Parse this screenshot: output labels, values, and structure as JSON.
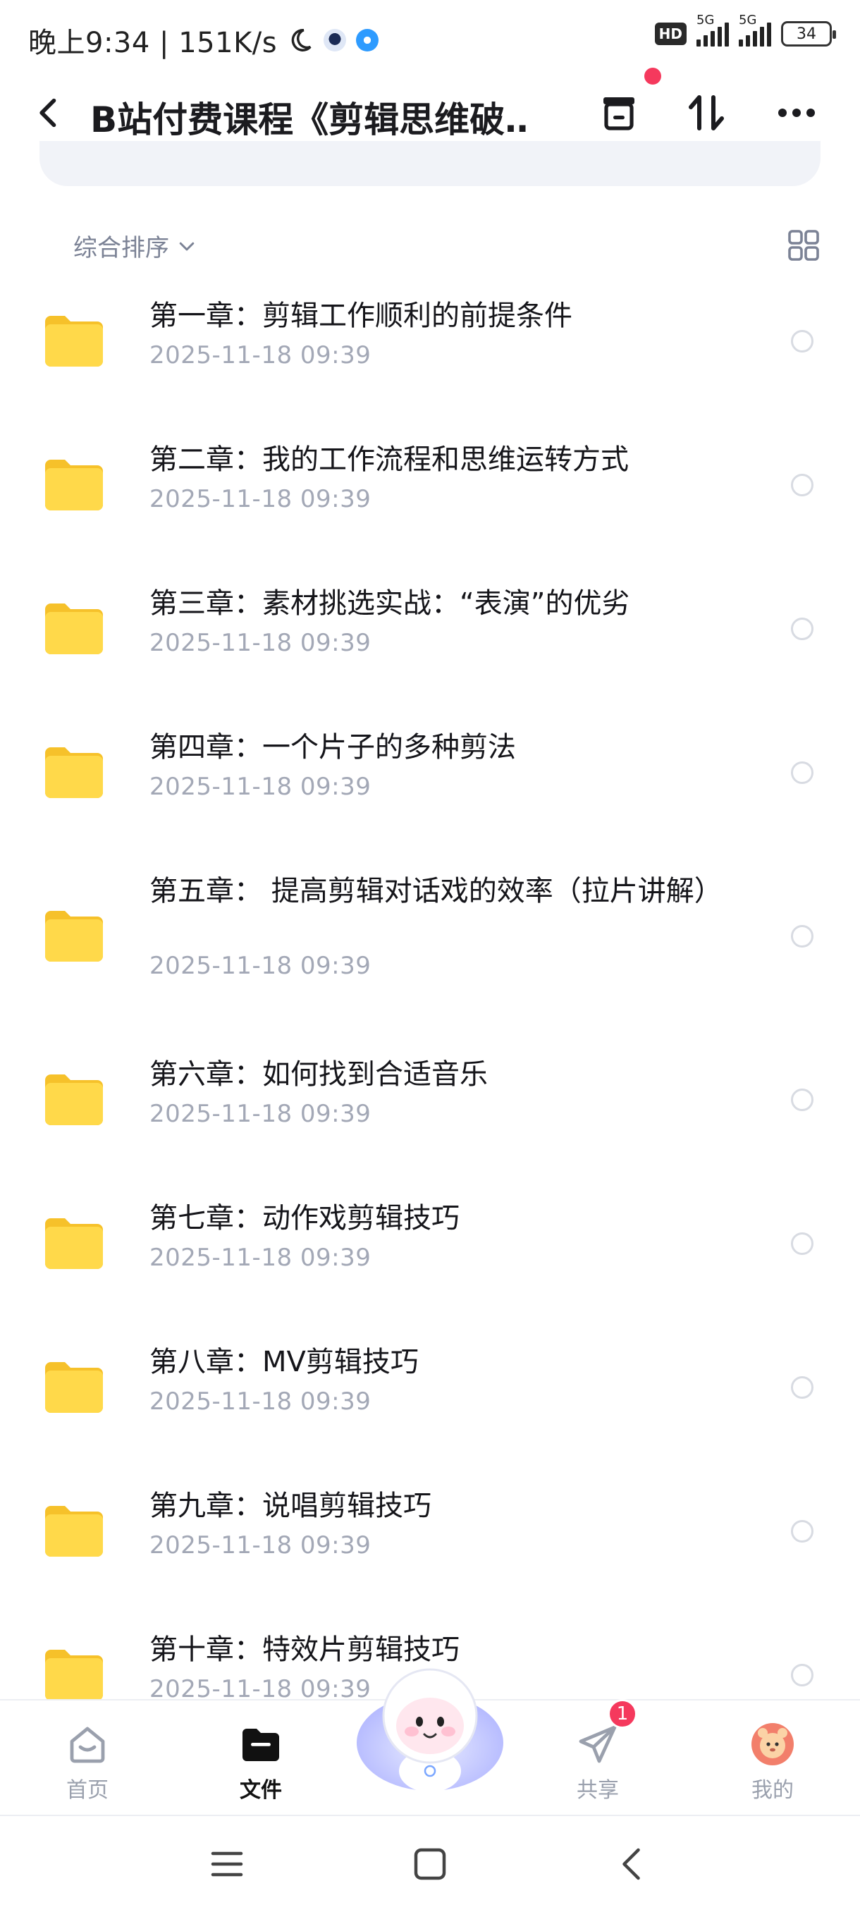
{
  "status_bar": {
    "text": "晚上9:34 | 151K/s",
    "hd": "HD",
    "signal1": "5G",
    "signal2": "5G",
    "battery": "34"
  },
  "nav": {
    "title": "B站付费课程《剪辑思维破…"
  },
  "sort": {
    "label": "综合排序"
  },
  "files": [
    {
      "name": "第一章：剪辑工作顺利的前提条件",
      "date": "2025-11-18  09:39"
    },
    {
      "name": "第二章：我的工作流程和思维运转方式",
      "date": "2025-11-18  09:39"
    },
    {
      "name": "第三章：素材挑选实战：“表演”的优劣",
      "date": "2025-11-18  09:39"
    },
    {
      "name": "第四章：一个片子的多种剪法",
      "date": "2025-11-18  09:39"
    },
    {
      "name": "第五章： 提高剪辑对话戏的效率（拉片讲解）",
      "date": "2025-11-18  09:39"
    },
    {
      "name": "第六章：如何找到合适音乐",
      "date": "2025-11-18  09:39"
    },
    {
      "name": "第七章：动作戏剪辑技巧",
      "date": "2025-11-18  09:39"
    },
    {
      "name": "第八章：MV剪辑技巧",
      "date": "2025-11-18  09:39"
    },
    {
      "name": "第九章：说唱剪辑技巧",
      "date": "2025-11-18  09:39"
    },
    {
      "name": "第十章：特效片剪辑技巧",
      "date": "2025-11-18  09:39"
    }
  ],
  "tabs": [
    {
      "label": "首页",
      "icon": "home-icon"
    },
    {
      "label": "文件",
      "icon": "folder-icon"
    },
    {
      "label": "共享",
      "icon": "share-plane-icon"
    },
    {
      "label": "我的",
      "icon": "avatar-icon"
    }
  ],
  "share_badge": "1",
  "colors": {
    "folder": "#FFD23F",
    "accent_red": "#F5395D",
    "muted": "#A3A8B6"
  }
}
